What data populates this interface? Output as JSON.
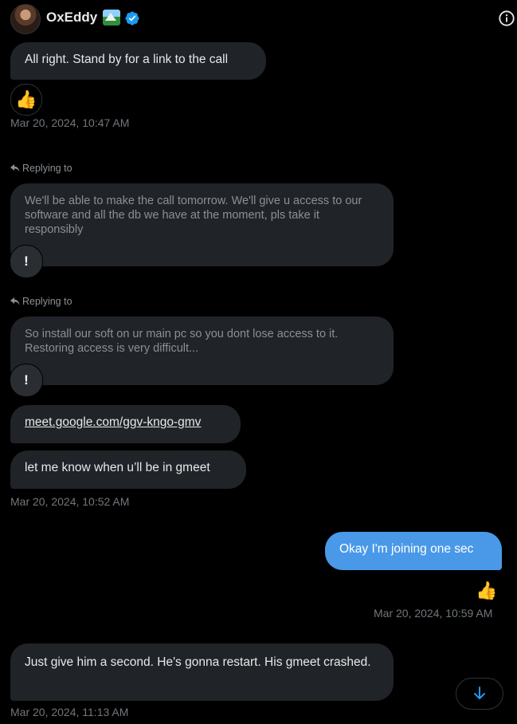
{
  "header": {
    "name": "OxEddy",
    "icons": {
      "avatar": "profile-photo",
      "name_emoji": "mountain-landscape-emoji",
      "verified": "verified-badge-icon",
      "info": "info-icon"
    },
    "accent": "#1d9bf0"
  },
  "messages": {
    "m1": {
      "text": "All right. Stand by for a link to the call",
      "reaction": "👍",
      "time": "Mar 20, 2024, 10:47 AM"
    },
    "r1": {
      "label": "Replying to",
      "quote": "We'll be able to make the call tomorrow. We'll give u access to our software and all the db we have at the moment, pls take it responsibly",
      "reaction": "!"
    },
    "r2": {
      "label": "Replying to",
      "quote": "So install our soft on ur main pc so you dont lose access to it. Restoring access is very difficult...",
      "reaction": "!"
    },
    "m2": {
      "text": "meet.google.com/ggv-kngo-gmv"
    },
    "m3": {
      "text": "let me know when u’ll be in gmeet",
      "time": "Mar 20, 2024, 10:52 AM"
    },
    "mine1": {
      "text": "Okay I'm joining one sec",
      "reaction": "👍",
      "time": "Mar 20, 2024, 10:59 AM"
    },
    "m4": {
      "text": "Just give him a second. He's gonna restart. His gmeet crashed.",
      "time": "Mar 20, 2024, 11:13 AM"
    }
  },
  "colors": {
    "background": "#000000",
    "bubble_received": "#202327",
    "bubble_sent": "#4a99e9",
    "muted_text": "#71767b"
  },
  "controls": {
    "scroll_down_icon": "arrow-down-icon"
  }
}
